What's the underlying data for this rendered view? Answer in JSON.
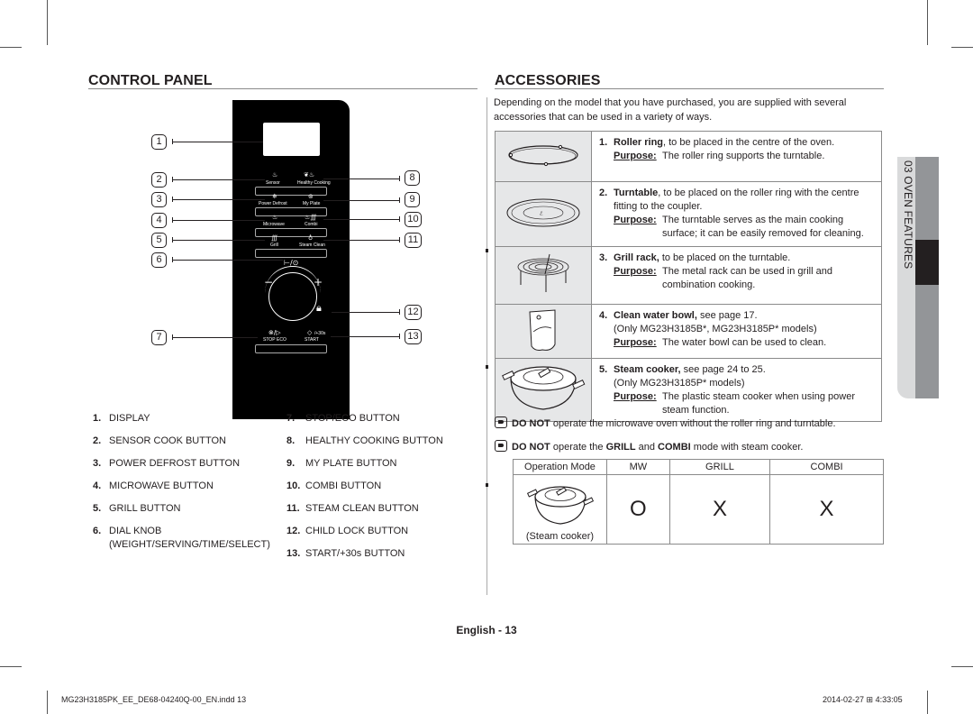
{
  "control_panel": {
    "title": "CONTROL PANEL",
    "panel_labels": {
      "sensor": "Sensor",
      "healthy_cooking": "Healthy Cooking",
      "power_defrost": "Power Defrost",
      "my_plate": "My Plate",
      "microwave": "Microwave",
      "combi": "Combi",
      "grill": "Grill",
      "steam_clean": "Steam Clean",
      "stop": "STOP",
      "eco": "ECO",
      "start": "START",
      "plus30": "/+30s",
      "minus": "−",
      "plus": "+"
    },
    "callouts": [
      "1",
      "2",
      "3",
      "4",
      "5",
      "6",
      "7",
      "8",
      "9",
      "10",
      "11",
      "12",
      "13"
    ],
    "legend": [
      {
        "num": "1.",
        "label": "DISPLAY"
      },
      {
        "num": "2.",
        "label": "SENSOR COOK BUTTON"
      },
      {
        "num": "3.",
        "label": "POWER DEFROST BUTTON"
      },
      {
        "num": "4.",
        "label": "MICROWAVE BUTTON"
      },
      {
        "num": "5.",
        "label": "GRILL BUTTON"
      },
      {
        "num": "6.",
        "label": "DIAL KNOB",
        "label2": "(WEIGHT/SERVING/TIME/SELECT)"
      },
      {
        "num": "7.",
        "label": "STOP/ECO BUTTON"
      },
      {
        "num": "8.",
        "label": "HEALTHY COOKING BUTTON"
      },
      {
        "num": "9.",
        "label": "MY PLATE BUTTON"
      },
      {
        "num": "10.",
        "label": "COMBI BUTTON"
      },
      {
        "num": "11.",
        "label": "STEAM CLEAN BUTTON"
      },
      {
        "num": "12.",
        "label": "CHILD LOCK BUTTON"
      },
      {
        "num": "13.",
        "label": "START/+30s BUTTON"
      }
    ]
  },
  "accessories": {
    "title": "ACCESSORIES",
    "intro": "Depending on the model that you have purchased, you are supplied with several accessories that can be used in a variety of ways.",
    "purpose_label": "Purpose:",
    "items": [
      {
        "num": "1.",
        "name": "Roller ring",
        "desc": ", to be placed in the centre of the oven.",
        "purpose": "The roller ring supports the turntable.",
        "purpose2": ""
      },
      {
        "num": "2.",
        "name": "Turntable",
        "desc": ", to be placed on the roller ring with the centre",
        "desc2": "fitting to the coupler.",
        "purpose": "The turntable serves as the main cooking",
        "purpose2": "surface; it can be easily removed for cleaning."
      },
      {
        "num": "3.",
        "name": "Grill rack,",
        "desc": " to be placed on the turntable.",
        "purpose": "The metal rack can be used in grill and",
        "purpose2": "combination cooking."
      },
      {
        "num": "4.",
        "name": "Clean water bowl,",
        "desc": " see page 17.",
        "desc2": "(Only MG23H3185B*, MG23H3185P* models)",
        "purpose": "The water bowl can be used to clean.",
        "purpose2": ""
      },
      {
        "num": "5.",
        "name": "Steam cooker,",
        "desc": " see page 24 to 25.",
        "desc2": "(Only MG23H3185P* models)",
        "purpose": "The plastic steam cooker when using power",
        "purpose2": "steam function."
      }
    ],
    "notes": [
      {
        "bold1": "DO NOT",
        "text1": " operate the microwave oven without the roller ring and turntable."
      },
      {
        "bold1": "DO NOT",
        "text1": " operate the ",
        "bold2": "GRILL",
        "text2": " and ",
        "bold3": "COMBI",
        "text3": " mode with steam cooker."
      }
    ],
    "mode_table": {
      "headers": [
        "Operation Mode",
        "MW",
        "GRILL",
        "COMBI"
      ],
      "row_label": "(Steam cooker)",
      "values": [
        "O",
        "X",
        "X"
      ]
    }
  },
  "side_tab": {
    "label": "03  OVEN FEATURES"
  },
  "footer": {
    "page_label": "English - 13",
    "file_slug": "MG23H3185PK_EE_DE68-04240Q-00_EN.indd   13",
    "timestamp": "2014-02-27   ⊞ 4:33:05"
  },
  "colors": {
    "text": "#231f20",
    "tab_light": "#d9dadb",
    "tab_mid": "#939598",
    "tab_dark": "#231f20",
    "image_cell_bg": "#e6e7e8"
  }
}
